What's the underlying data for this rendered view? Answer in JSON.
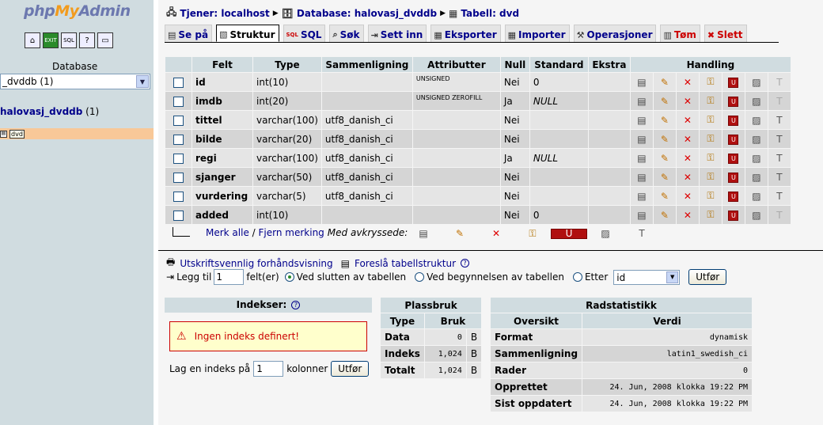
{
  "left": {
    "logo_php": "php",
    "logo_my": "My",
    "logo_admin": "Admin",
    "icons": [
      "home-icon",
      "exit-icon",
      "sql-icon",
      "docs-icon",
      "query-window-icon"
    ],
    "database_label": "Database",
    "database_select_value": "_dvddb (1)",
    "database_link": "halovasj_dvddb",
    "database_count": " (1)",
    "table_item": "dvd"
  },
  "breadcrumb": {
    "server": "Tjener: localhost",
    "database": "Database: halovasj_dvddb",
    "table": "Tabell: dvd"
  },
  "tabs": [
    {
      "label": "Se på",
      "icon": "browse-icon"
    },
    {
      "label": "Struktur",
      "icon": "structure-icon",
      "active": true
    },
    {
      "label": "SQL",
      "icon": "sql-icon"
    },
    {
      "label": "Søk",
      "icon": "search-icon"
    },
    {
      "label": "Sett inn",
      "icon": "insert-icon"
    },
    {
      "label": "Eksporter",
      "icon": "export-icon"
    },
    {
      "label": "Importer",
      "icon": "import-icon"
    },
    {
      "label": "Operasjoner",
      "icon": "operations-icon"
    },
    {
      "label": "Tøm",
      "icon": "empty-icon"
    },
    {
      "label": "Slett",
      "icon": "drop-icon"
    }
  ],
  "structure": {
    "headers": {
      "field": "Felt",
      "type": "Type",
      "collation": "Sammenligning",
      "attributes": "Attributter",
      "null": "Null",
      "default": "Standard",
      "extra": "Ekstra",
      "action": "Handling"
    },
    "rows": [
      {
        "name": "id",
        "type": "int(10)",
        "collation": "",
        "attributes": "UNSIGNED",
        "null": "Nei",
        "default": "0",
        "default_italic": false,
        "extra": "",
        "fulltext": false
      },
      {
        "name": "imdb",
        "type": "int(20)",
        "collation": "",
        "attributes": "UNSIGNED ZEROFILL",
        "null": "Ja",
        "default": "NULL",
        "default_italic": true,
        "extra": "",
        "fulltext": false
      },
      {
        "name": "tittel",
        "type": "varchar(100)",
        "collation": "utf8_danish_ci",
        "attributes": "",
        "null": "Nei",
        "default": "",
        "default_italic": false,
        "extra": "",
        "fulltext": true
      },
      {
        "name": "bilde",
        "type": "varchar(20)",
        "collation": "utf8_danish_ci",
        "attributes": "",
        "null": "Nei",
        "default": "",
        "default_italic": false,
        "extra": "",
        "fulltext": true
      },
      {
        "name": "regi",
        "type": "varchar(100)",
        "collation": "utf8_danish_ci",
        "attributes": "",
        "null": "Ja",
        "default": "NULL",
        "default_italic": true,
        "extra": "",
        "fulltext": true
      },
      {
        "name": "sjanger",
        "type": "varchar(50)",
        "collation": "utf8_danish_ci",
        "attributes": "",
        "null": "Nei",
        "default": "",
        "default_italic": false,
        "extra": "",
        "fulltext": true
      },
      {
        "name": "vurdering",
        "type": "varchar(5)",
        "collation": "utf8_danish_ci",
        "attributes": "",
        "null": "Nei",
        "default": "",
        "default_italic": false,
        "extra": "",
        "fulltext": true
      },
      {
        "name": "added",
        "type": "int(10)",
        "collation": "",
        "attributes": "",
        "null": "Nei",
        "default": "0",
        "default_italic": false,
        "extra": "",
        "fulltext": false
      }
    ],
    "check_all": "Merk alle",
    "separator": " / ",
    "uncheck_all": "Fjern merking",
    "with_selected": "Med avkryssede:"
  },
  "print_view": "Utskriftsvennlig forhåndsvisning",
  "propose_structure": "Foreslå tabellstruktur",
  "add_fields": {
    "label": "Legg til",
    "count": "1",
    "fields_label": "felt(er)",
    "opt_end": "Ved slutten av tabellen",
    "opt_begin": "Ved begynnelsen av tabellen",
    "opt_after": "Etter",
    "after_value": "id",
    "go": "Utfør"
  },
  "indexes": {
    "title": "Indekser:",
    "warning": "Ingen indeks definert!",
    "create_label": "Lag en indeks på",
    "create_count": "1",
    "create_suffix": "kolonner",
    "go": "Utfør"
  },
  "space": {
    "title": "Plassbruk",
    "col_type": "Type",
    "col_usage": "Bruk",
    "rows": [
      {
        "label": "Data",
        "value": "0",
        "unit": "B"
      },
      {
        "label": "Indeks",
        "value": "1,024",
        "unit": "B"
      },
      {
        "label": "Totalt",
        "value": "1,024",
        "unit": "B"
      }
    ]
  },
  "rowstats": {
    "title": "Radstatistikk",
    "col_overview": "Oversikt",
    "col_value": "Verdi",
    "rows": [
      {
        "label": "Format",
        "value": "dynamisk"
      },
      {
        "label": "Sammenligning",
        "value": "latin1_swedish_ci"
      },
      {
        "label": "Rader",
        "value": "0"
      },
      {
        "label": "Opprettet",
        "value": "24. Jun, 2008 klokka 19:22 PM"
      },
      {
        "label": "Sist oppdatert",
        "value": "24. Jun, 2008 klokka 19:22 PM"
      }
    ]
  },
  "colors": {
    "left_bg": "#d0dce0",
    "header_bg": "#d0dce0",
    "row_odd": "#e5e5e5",
    "row_even": "#d5d5d5",
    "link": "#00008b",
    "selected_table_bg": "#f8c898",
    "warning": "#cc0000"
  }
}
